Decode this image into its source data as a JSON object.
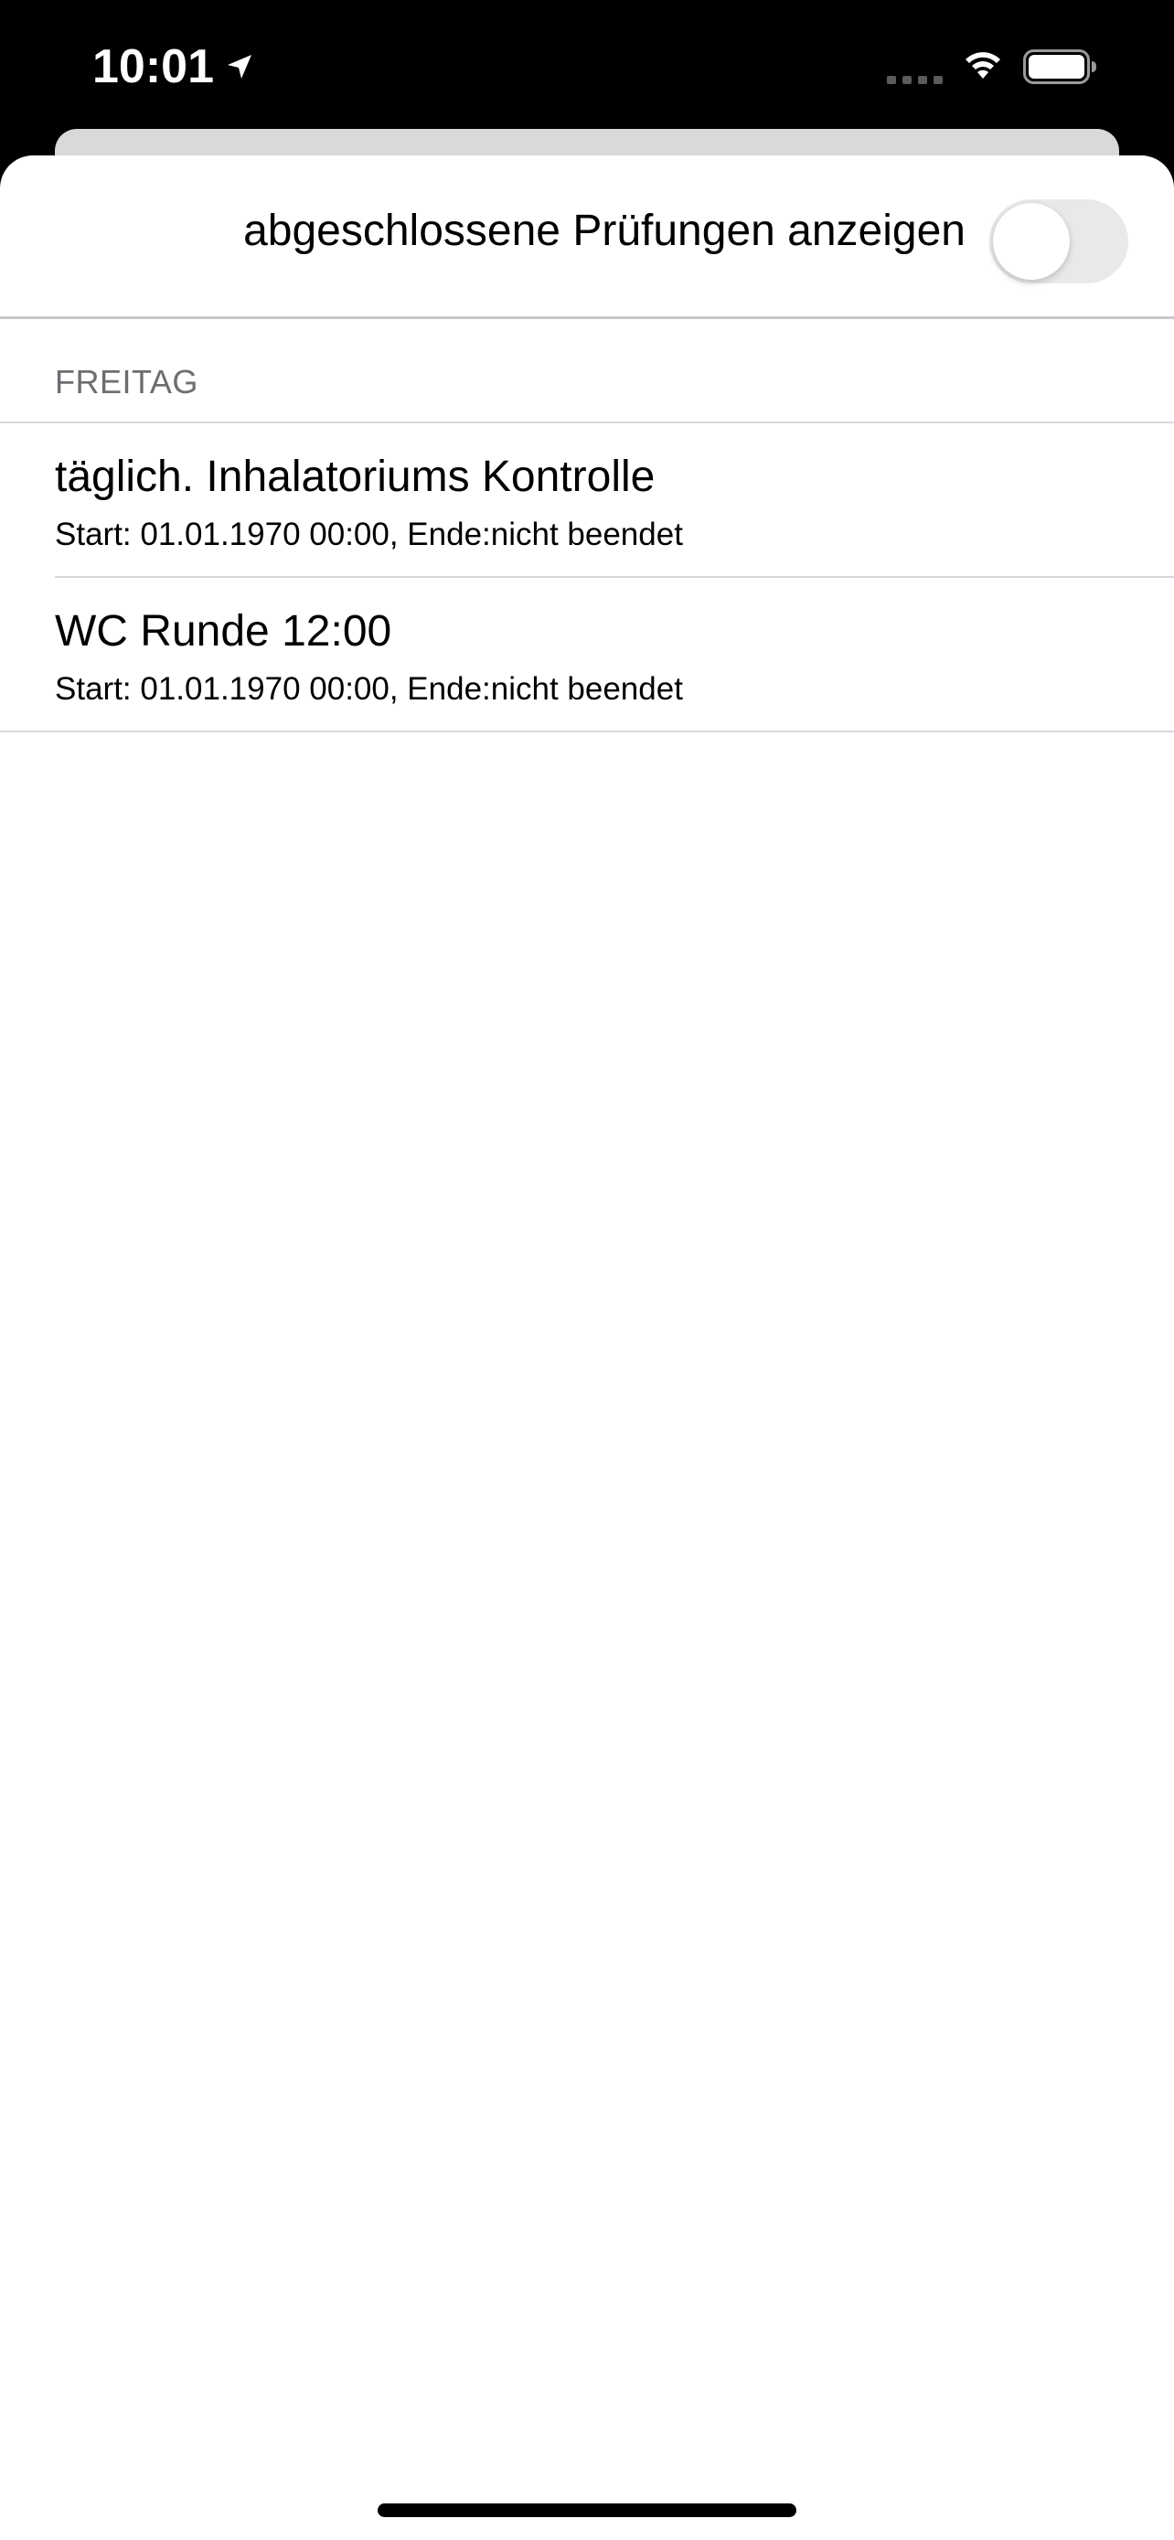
{
  "status_bar": {
    "time": "10:01",
    "icons": [
      "location-arrow-icon",
      "cellular-signal-icon",
      "wifi-icon",
      "battery-icon"
    ]
  },
  "sheet": {
    "toggle": {
      "label": "abgeschlossene Prüfungen anzeigen",
      "is_on": false
    },
    "section_header": "FREITAG",
    "items": [
      {
        "title": "täglich. Inhalatoriums Kontrolle",
        "subtitle": "Start: 01.01.1970 00:00, Ende:nicht beendet"
      },
      {
        "title": "WC Runde 12:00",
        "subtitle": "Start: 01.01.1970 00:00, Ende:nicht beendet"
      }
    ]
  },
  "colors": {
    "background": "#000000",
    "sheet": "#ffffff",
    "switch_off": "#e9e9ea",
    "section_header_text": "#6d6d72",
    "separator": "#d8d8dc"
  }
}
